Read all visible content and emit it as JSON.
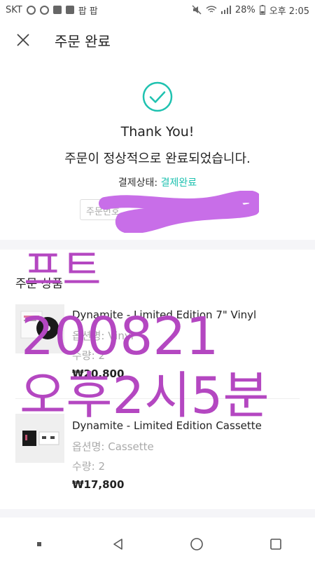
{
  "status_bar": {
    "carrier": "SKT",
    "notif_text": "팝 팝",
    "battery": "28%",
    "time": "오후 2:05"
  },
  "header": {
    "title": "주문 완료",
    "close_icon": "close-icon"
  },
  "confirmation": {
    "icon": "check-circle-icon",
    "accent": "#1fc2b0",
    "thanks": "Thank You!",
    "message": "주문이 정상적으로 완료되었습니다.",
    "payment_label": "결제상태:",
    "payment_value": "결제완료",
    "order_number_partial": "주문번호"
  },
  "order_section": {
    "title": "주문 상품",
    "items": [
      {
        "name": "Dynamite - Limited Edition 7\" Vinyl",
        "option_label": "옵션명:",
        "option_value": "Vinyl",
        "qty_label": "수량:",
        "qty_value": "2",
        "price": "₩20,800"
      },
      {
        "name": "Dynamite - Limited Edition Cassette",
        "option_label": "옵션명:",
        "option_value": "Cassette",
        "qty_label": "수량:",
        "qty_value": "2",
        "price": "₩17,800"
      }
    ]
  },
  "overlay": {
    "line1": "프트",
    "line2": "200821",
    "line3": "오후2시5분",
    "color": "#b447c1"
  },
  "navbar": {
    "recent_icon": "recents-dot-icon",
    "back_icon": "back-triangle-icon",
    "home_icon": "home-circle-icon",
    "overview_icon": "overview-square-icon"
  }
}
